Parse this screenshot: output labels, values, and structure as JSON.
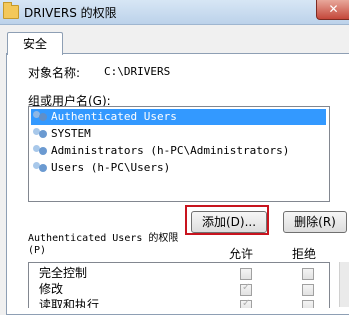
{
  "window": {
    "title": "DRIVERS 的权限",
    "close_label": "✕",
    "accent_close_color": "#c4473a"
  },
  "tabs": [
    {
      "label": "安全",
      "selected": true
    }
  ],
  "security": {
    "object_name_label": "对象名称:",
    "object_name_value": "C:\\DRIVERS",
    "groups_label": "组或用户名(G):",
    "groups": [
      {
        "name": "Authenticated Users",
        "icon": "users-icon",
        "selected": true
      },
      {
        "name": "SYSTEM",
        "icon": "users-icon",
        "selected": false
      },
      {
        "name": "Administrators (h-PC\\Administrators)",
        "icon": "users-icon",
        "selected": false
      },
      {
        "name": "Users (h-PC\\Users)",
        "icon": "users-icon",
        "selected": false
      }
    ],
    "add_button": "添加(D)...",
    "remove_button": "删除(R)",
    "permissions_title": "Authenticated Users 的权限\n(P)",
    "allow_header": "允许",
    "deny_header": "拒绝",
    "permissions": [
      {
        "name": "完全控制",
        "allow": false,
        "deny": false
      },
      {
        "name": "修改",
        "allow": true,
        "deny": false
      },
      {
        "name": "读取和执行",
        "allow": true,
        "deny": false
      }
    ]
  }
}
